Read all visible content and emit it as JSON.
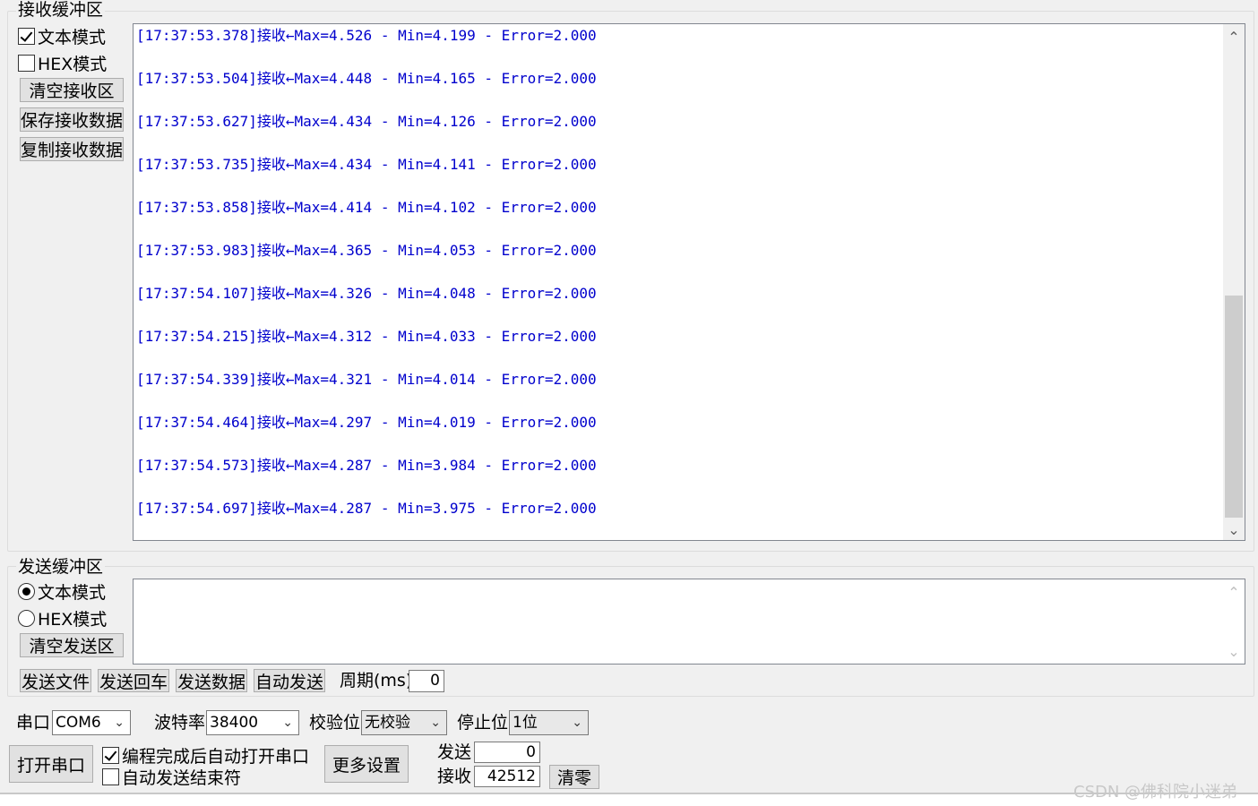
{
  "receive": {
    "group_title": "接收缓冲区",
    "text_mode_label": "文本模式",
    "text_mode_checked": true,
    "hex_mode_label": "HEX模式",
    "hex_mode_checked": false,
    "clear_label": "清空接收区",
    "save_label": "保存接收数据",
    "copy_label": "复制接收数据",
    "lines": [
      "[17:37:53.378]接收←Max=4.526 - Min=4.199 - Error=2.000",
      "[17:37:53.504]接收←Max=4.448 - Min=4.165 - Error=2.000",
      "[17:37:53.627]接收←Max=4.434 - Min=4.126 - Error=2.000",
      "[17:37:53.735]接收←Max=4.434 - Min=4.141 - Error=2.000",
      "[17:37:53.858]接收←Max=4.414 - Min=4.102 - Error=2.000",
      "[17:37:53.983]接收←Max=4.365 - Min=4.053 - Error=2.000",
      "[17:37:54.107]接收←Max=4.326 - Min=4.048 - Error=2.000",
      "[17:37:54.215]接收←Max=4.312 - Min=4.033 - Error=2.000",
      "[17:37:54.339]接收←Max=4.321 - Min=4.014 - Error=2.000",
      "[17:37:54.464]接收←Max=4.297 - Min=4.019 - Error=2.000",
      "[17:37:54.573]接收←Max=4.287 - Min=3.984 - Error=2.000",
      "[17:37:54.697]接收←Max=4.287 - Min=3.975 - Error=2.000"
    ],
    "text_color": "#0000cd"
  },
  "send": {
    "group_title": "发送缓冲区",
    "text_mode_label": "文本模式",
    "text_mode_selected": true,
    "hex_mode_label": "HEX模式",
    "hex_mode_selected": false,
    "clear_label": "清空发送区",
    "content": "",
    "send_file_label": "发送文件",
    "send_enter_label": "发送回车",
    "send_data_label": "发送数据",
    "auto_send_label": "自动发送",
    "period_label": "周期(ms)",
    "period_value": "0"
  },
  "settings": {
    "port_label": "串口",
    "port_value": "COM6",
    "baud_label": "波特率",
    "baud_value": "38400",
    "parity_label": "校验位",
    "parity_value": "无校验",
    "stop_label": "停止位",
    "stop_value": "1位",
    "open_port_label": "打开串口",
    "auto_open_label": "编程完成后自动打开串口",
    "auto_open_checked": true,
    "auto_send_end_label": "自动发送结束符",
    "auto_send_end_checked": false,
    "more_settings_label": "更多设置",
    "tx_label": "发送",
    "tx_count": "0",
    "rx_label": "接收",
    "rx_count": "42512",
    "reset_label": "清零"
  },
  "watermark": "CSDN @佛科院小迷弟"
}
